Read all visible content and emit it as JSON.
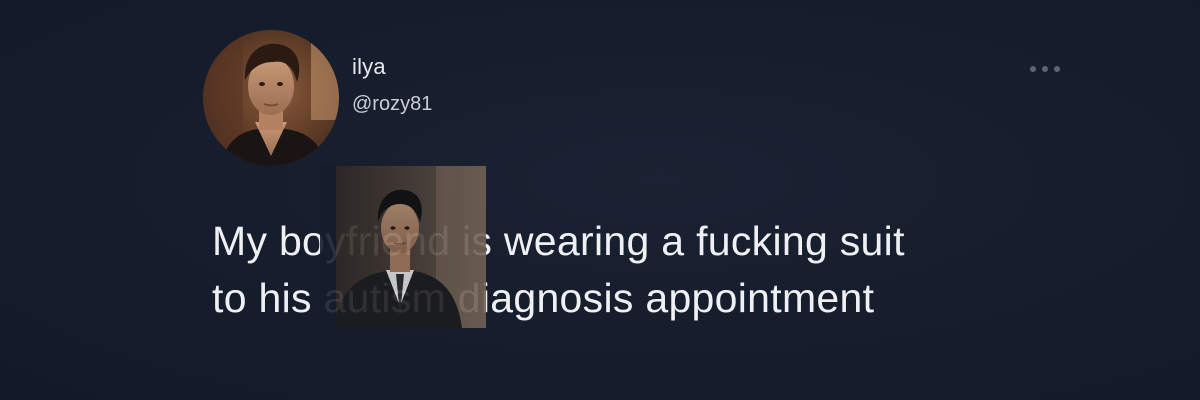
{
  "tweet": {
    "display_name": "ilya",
    "handle": "@rozy81",
    "text": "My boyfriend is wearing a fucking suit\nto his autism diagnosis appointment"
  },
  "icons": {
    "more": "more-horizontal-icon",
    "avatar": "profile-photo",
    "overlay": "suited-man-photo"
  },
  "colors": {
    "background": "#151d2c",
    "text_primary": "#eef0f3",
    "text_secondary": "#c9ced6",
    "icon_muted": "#5d6677"
  }
}
